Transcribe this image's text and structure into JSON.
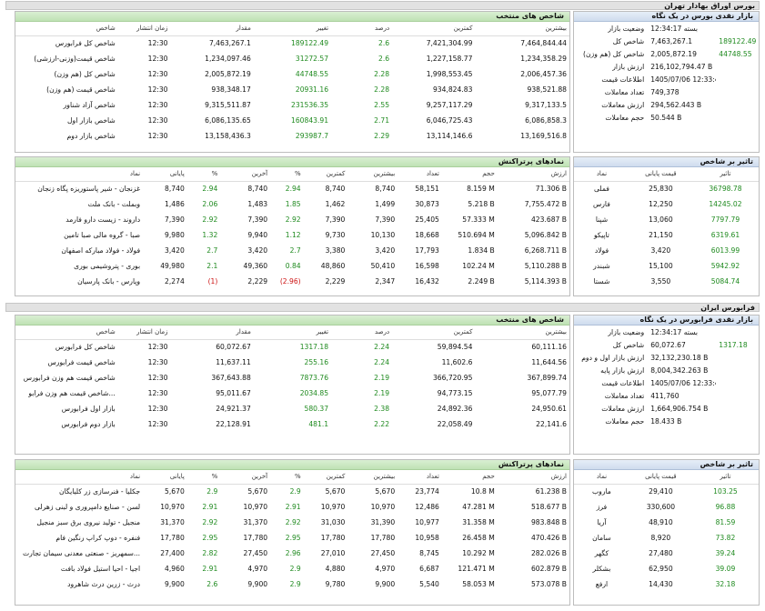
{
  "tehran": {
    "title": "بورس اوراق بهادار تهران",
    "summary_title": "بازار نقدی بورس در یک نگاه",
    "summary": [
      {
        "k": "وضعیت بازار",
        "v": "بسته 12:34:17",
        "d": ""
      },
      {
        "k": "شاخص کل",
        "v": "7,463,267.1",
        "d": "189122.49"
      },
      {
        "k": "شاخص کل (هم وزن)",
        "v": "2,005,872.19",
        "d": "44748.55"
      },
      {
        "k": "ارزش بازار",
        "v": "216,102,794.47 B",
        "d": ""
      },
      {
        "k": "اطلاعات قیمت",
        "v": "1405/07/06 12:33:49",
        "d": ""
      },
      {
        "k": "تعداد معاملات",
        "v": "749,378",
        "d": ""
      },
      {
        "k": "ارزش معاملات",
        "v": "294,562.443 B",
        "d": ""
      },
      {
        "k": "حجم معاملات",
        "v": "50.544 B",
        "d": ""
      }
    ],
    "index_title": "شاخص های منتخب",
    "index_headers": [
      "شاخص",
      "زمان انتشار",
      "مقدار",
      "تغییر",
      "درصد",
      "کمترین",
      "بیشترین"
    ],
    "index_rows": [
      [
        "شاخص کل فرابورس",
        "12:30",
        "7,463,267.1",
        "189122.49",
        "2.6",
        "7,421,304.99",
        "7,464,844.44"
      ],
      [
        "شاخص قیمت(وزنی-ارزشی)",
        "12:30",
        "1,234,097.46",
        "31272.57",
        "2.6",
        "1,227,158.77",
        "1,234,358.29"
      ],
      [
        "شاخص کل (هم وزن)",
        "12:30",
        "2,005,872.19",
        "44748.55",
        "2.28",
        "1,998,553.45",
        "2,006,457.36"
      ],
      [
        "شاخص قیمت (هم وزن)",
        "12:30",
        "938,348.17",
        "20931.16",
        "2.28",
        "934,824.83",
        "938,521.88"
      ],
      [
        "شاخص آزاد شناور",
        "12:30",
        "9,315,511.87",
        "231536.35",
        "2.55",
        "9,257,117.29",
        "9,317,133.5"
      ],
      [
        "شاخص بازار اول",
        "12:30",
        "6,086,135.65",
        "160843.91",
        "2.71",
        "6,046,725.43",
        "6,086,858.3"
      ],
      [
        "شاخص بازار دوم",
        "12:30",
        "13,158,436.3",
        "293987.7",
        "2.29",
        "13,114,146.6",
        "13,169,516.8"
      ]
    ],
    "impact_title": "تاثیر بر شاخص",
    "impact_headers": [
      "نماد",
      "قیمت پایانی",
      "تاثیر"
    ],
    "impact_rows": [
      [
        "فملی",
        "25,830",
        "36798.78"
      ],
      [
        "فارس",
        "12,250",
        "14245.02"
      ],
      [
        "شپنا",
        "13,060",
        "7797.79"
      ],
      [
        "تاپیکو",
        "21,150",
        "6319.61"
      ],
      [
        "فولاد",
        "3,420",
        "6013.99"
      ],
      [
        "شبندر",
        "15,100",
        "5942.92"
      ],
      [
        "شستا",
        "3,550",
        "5084.74"
      ]
    ],
    "traded_title": "نمادهای پرتراکنش",
    "traded_headers": [
      "نماد",
      "پایانی",
      "%",
      "آخرین",
      "%",
      "کمترین",
      "بیشترین",
      "تعداد",
      "حجم",
      "ارزش"
    ],
    "traded_rows": [
      [
        "غزنجان - شیر پاستوریزه پگاه زنجان",
        "8,740",
        "2.94",
        "8,740",
        "2.94",
        "8,740",
        "8,740",
        "58,151",
        "8.159 M",
        "71.306 B"
      ],
      [
        "وبملت - بانک ملت",
        "1,486",
        "2.06",
        "1,483",
        "1.85",
        "1,462",
        "1,499",
        "30,873",
        "5.218 B",
        "7,755.472 B"
      ],
      [
        "داروند - زیست دارو فارمد",
        "7,390",
        "2.92",
        "7,390",
        "2.92",
        "7,390",
        "7,390",
        "25,405",
        "57.333 M",
        "423.687 B"
      ],
      [
        "صبا - گروه مالی صبا تامین",
        "9,980",
        "1.32",
        "9,940",
        "1.12",
        "9,730",
        "10,130",
        "18,668",
        "510.694 M",
        "5,096.842 B"
      ],
      [
        "فولاد - فولاد مبارکه اصفهان",
        "3,420",
        "2.7",
        "3,420",
        "2.7",
        "3,380",
        "3,420",
        "17,793",
        "1.834 B",
        "6,268.711 B"
      ],
      [
        "بوری - پتروشیمی بوری",
        "49,980",
        "2.1",
        "49,360",
        "0.84",
        "48,860",
        "50,410",
        "16,598",
        "102.24 M",
        "5,110.288 B"
      ],
      [
        "وپارس - بانک پارسیان",
        "2,274",
        "(1)",
        "2,229",
        "(2.96)",
        "2,229",
        "2,347",
        "16,432",
        "2.249 B",
        "5,114.393 B"
      ]
    ]
  },
  "farabourse": {
    "title": "فرابورس ایران",
    "summary_title": "بازار نقدی فرابورس در یک نگاه",
    "summary": [
      {
        "k": "وضعیت بازار",
        "v": "بسته 12:34:17",
        "d": ""
      },
      {
        "k": "شاخص کل",
        "v": "60,072.67",
        "d": "1317.18"
      },
      {
        "k": "ارزش بازار اول و دوم",
        "v": "32,132,230.18 B",
        "d": ""
      },
      {
        "k": "ارزش بازار پایه",
        "v": "8,004,342.263 B",
        "d": ""
      },
      {
        "k": "اطلاعات قیمت",
        "v": "1405/07/06 12:33:49",
        "d": ""
      },
      {
        "k": "تعداد معاملات",
        "v": "411,760",
        "d": ""
      },
      {
        "k": "ارزش معاملات",
        "v": "1,664,906.754 B",
        "d": ""
      },
      {
        "k": "حجم معاملات",
        "v": "18.433 B",
        "d": ""
      }
    ],
    "index_title": "شاخص های منتخب",
    "index_headers": [
      "شاخص",
      "زمان انتشار",
      "مقدار",
      "تغییر",
      "درصد",
      "کمترین",
      "بیشترین"
    ],
    "index_rows": [
      [
        "شاخص کل فرابورس",
        "12:30",
        "60,072.67",
        "1317.18",
        "2.24",
        "59,894.54",
        "60,111.16"
      ],
      [
        "شاخص قیمت فرابورس",
        "12:30",
        "11,637.11",
        "255.16",
        "2.24",
        "11,602.6",
        "11,644.56"
      ],
      [
        "شاخص قیمت هم وزن فرابورس",
        "12:30",
        "367,643.88",
        "7873.76",
        "2.19",
        "366,720.95",
        "367,899.74"
      ],
      [
        "شاخص قیمت هم وزن فرابو...",
        "12:30",
        "95,011.67",
        "2034.85",
        "2.19",
        "94,773.15",
        "95,077.79"
      ],
      [
        "بازار اول فرابورس",
        "12:30",
        "24,921.37",
        "580.37",
        "2.38",
        "24,892.36",
        "24,950.61"
      ],
      [
        "بازار دوم فرابورس",
        "12:30",
        "22,128.91",
        "481.1",
        "2.22",
        "22,058.49",
        "22,141.6"
      ]
    ],
    "impact_title": "تاثیر بر شاخص",
    "impact_headers": [
      "نماد",
      "قیمت پایانی",
      "تاثیر"
    ],
    "impact_rows": [
      [
        "ماروب",
        "29,410",
        "103.25"
      ],
      [
        "فرز",
        "330,600",
        "96.88"
      ],
      [
        "آریا",
        "48,910",
        "81.59"
      ],
      [
        "سامان",
        "8,920",
        "73.82"
      ],
      [
        "کگهر",
        "27,480",
        "39.24"
      ],
      [
        "بشکلر",
        "62,950",
        "39.09"
      ],
      [
        "ارفع",
        "14,430",
        "32.18"
      ]
    ],
    "traded_title": "نمادهای پرتراکنش",
    "traded_headers": [
      "نماد",
      "پایانی",
      "%",
      "آخرین",
      "%",
      "کمترین",
      "بیشترین",
      "تعداد",
      "حجم",
      "ارزش"
    ],
    "traded_rows": [
      [
        "جکلیا - فنرسازی زر کلیایگان",
        "5,670",
        "2.9",
        "5,670",
        "2.9",
        "5,670",
        "5,670",
        "23,774",
        "10.8 M",
        "61.238 B"
      ],
      [
        "لسن - صنایع دامپروری و لبنی زهرلی",
        "10,970",
        "2.91",
        "10,970",
        "2.91",
        "10,970",
        "10,970",
        "12,486",
        "47.281 M",
        "518.677 B"
      ],
      [
        "منجیل - تولید نیروی برق سبز منجیل",
        "31,370",
        "2.92",
        "31,370",
        "2.92",
        "31,030",
        "31,390",
        "10,977",
        "31.358 M",
        "983.848 B"
      ],
      [
        "فنفره - دوپ کراپ رنگین فام",
        "17,780",
        "2.95",
        "17,780",
        "2.95",
        "17,780",
        "17,780",
        "10,958",
        "26.458 M",
        "470.426 B"
      ],
      [
        "سمهریز - صنعتی معدنی سیمان تجارت...",
        "27,400",
        "2.82",
        "27,450",
        "2.96",
        "27,010",
        "27,450",
        "8,745",
        "10.292 M",
        "282.026 B"
      ],
      [
        "اجیا - احیا استیل فولاد بافت",
        "4,960",
        "2.91",
        "4,970",
        "2.9",
        "4,880",
        "4,970",
        "6,687",
        "121.471 M",
        "602.879 B"
      ],
      [
        "درث - زرین درث شاهرود",
        "9,900",
        "2.6",
        "9,900",
        "2.9",
        "9,780",
        "9,900",
        "5,540",
        "58.053 M",
        "573.078 B"
      ]
    ]
  },
  "colors": {
    "up": "#1f8a1f",
    "down": "#c11",
    "green_header": "#c8e6be",
    "blue_header": "#d6e2f1"
  }
}
